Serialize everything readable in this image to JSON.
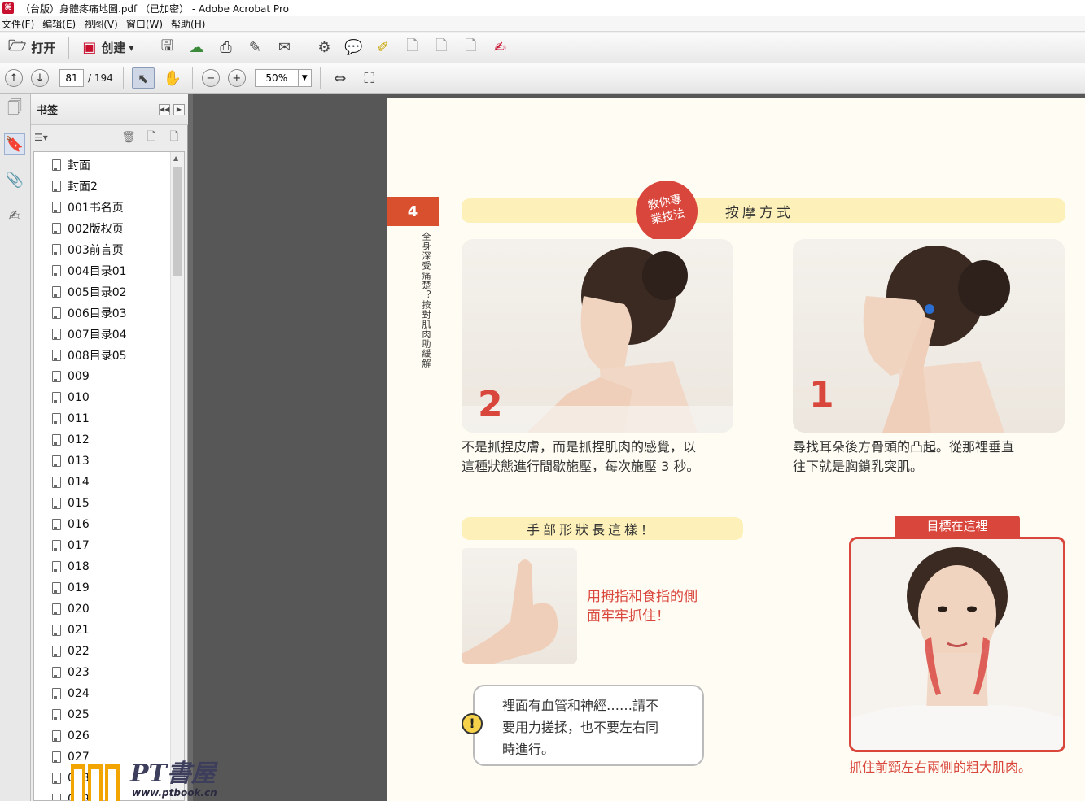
{
  "window": {
    "title": "（台版）身體疼痛地圖.pdf （已加密） - Adobe Acrobat Pro",
    "app_icon": "pdf-icon"
  },
  "menu": [
    "文件(F)",
    "编辑(E)",
    "视图(V)",
    "窗口(W)",
    "帮助(H)"
  ],
  "toolbar": {
    "open_label": "打开",
    "create_label": "创建",
    "create_arrow": "▾"
  },
  "nav": {
    "page_current": "81",
    "page_total": "/ 194",
    "zoom": "50%",
    "zoom_arrow": "▼"
  },
  "bookmarks": {
    "title": "书签",
    "items": [
      "封面",
      "封面2",
      "001书名页",
      "002版权页",
      "003前言页",
      "004目录01",
      "005目录02",
      "006目录03",
      "007目录04",
      "008目录05",
      "009",
      "010",
      "011",
      "012",
      "013",
      "014",
      "015",
      "016",
      "017",
      "018",
      "019",
      "020",
      "021",
      "022",
      "023",
      "024",
      "025",
      "026",
      "027",
      "028",
      "029"
    ]
  },
  "pdf_page": {
    "chapter_num": "4",
    "chapter_vertical": "全身深受痛楚？按對肌肉助緩解",
    "badge_line1": "教你專",
    "badge_line2": "業技法",
    "banner_title": "按摩方式",
    "step2_num": "2",
    "step2_cap1": "不是抓捏皮膚，而是抓捏肌肉的感覺，以",
    "step2_cap2": "這種狀態進行間歇施壓，每次施壓 3 秒。",
    "step1_num": "1",
    "step1_cap1": "尋找耳朵後方骨頭的凸起。從那裡垂直",
    "step1_cap2": "往下就是胸鎖乳突肌。",
    "hand_banner": "手部形狀長這樣！",
    "hand_text1": "用拇指和食指的側",
    "hand_text2": "面牢牢抓住！",
    "warn_icon": "!",
    "warn_line1": "裡面有血管和神經……請不",
    "warn_line2": "要用力搓揉，也不要左右同",
    "warn_line3": "時進行。",
    "target_tag": "目標在這裡",
    "target_cap": "抓住前頸左右兩側的粗大肌肉。"
  },
  "watermark": {
    "brand": "PT書屋",
    "url": "www.ptbook.cn"
  },
  "colors": {
    "accent_red": "#d9463c",
    "banner_yellow": "#fdf1b9",
    "page_bg": "#fffdf3",
    "viewer_bg": "#575757"
  }
}
